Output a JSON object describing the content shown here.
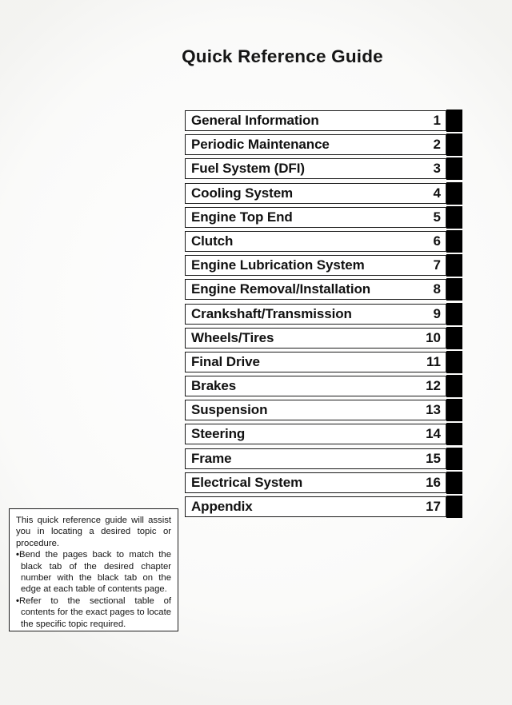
{
  "page": {
    "title": "Quick Reference Guide",
    "background_color": "#ffffff",
    "ink_color": "#111111",
    "tab_color": "#000000"
  },
  "chapters": [
    {
      "label": "General Information",
      "number": "1"
    },
    {
      "label": "Periodic Maintenance",
      "number": "2"
    },
    {
      "label": "Fuel System (DFI)",
      "number": "3"
    },
    {
      "label": "Cooling System",
      "number": "4"
    },
    {
      "label": "Engine Top End",
      "number": "5"
    },
    {
      "label": "Clutch",
      "number": "6"
    },
    {
      "label": "Engine Lubrication System",
      "number": "7"
    },
    {
      "label": "Engine Removal/Installation",
      "number": "8"
    },
    {
      "label": "Crankshaft/Transmission",
      "number": "9"
    },
    {
      "label": "Wheels/Tires",
      "number": "10"
    },
    {
      "label": "Final Drive",
      "number": "11"
    },
    {
      "label": "Brakes",
      "number": "12"
    },
    {
      "label": "Suspension",
      "number": "13"
    },
    {
      "label": "Steering",
      "number": "14"
    },
    {
      "label": "Frame",
      "number": "15"
    },
    {
      "label": "Electrical System",
      "number": "16"
    },
    {
      "label": "Appendix",
      "number": "17"
    }
  ],
  "note": {
    "paragraph": "This quick reference guide will assist you in locating a desired topic or procedure.",
    "bullet_char": "•",
    "items": [
      "Bend the pages back to match the black tab of the desired chapter number with the black tab on the edge at each table of contents page.",
      "Refer to the sectional table of contents for the exact pages to locate the specific topic required."
    ]
  }
}
